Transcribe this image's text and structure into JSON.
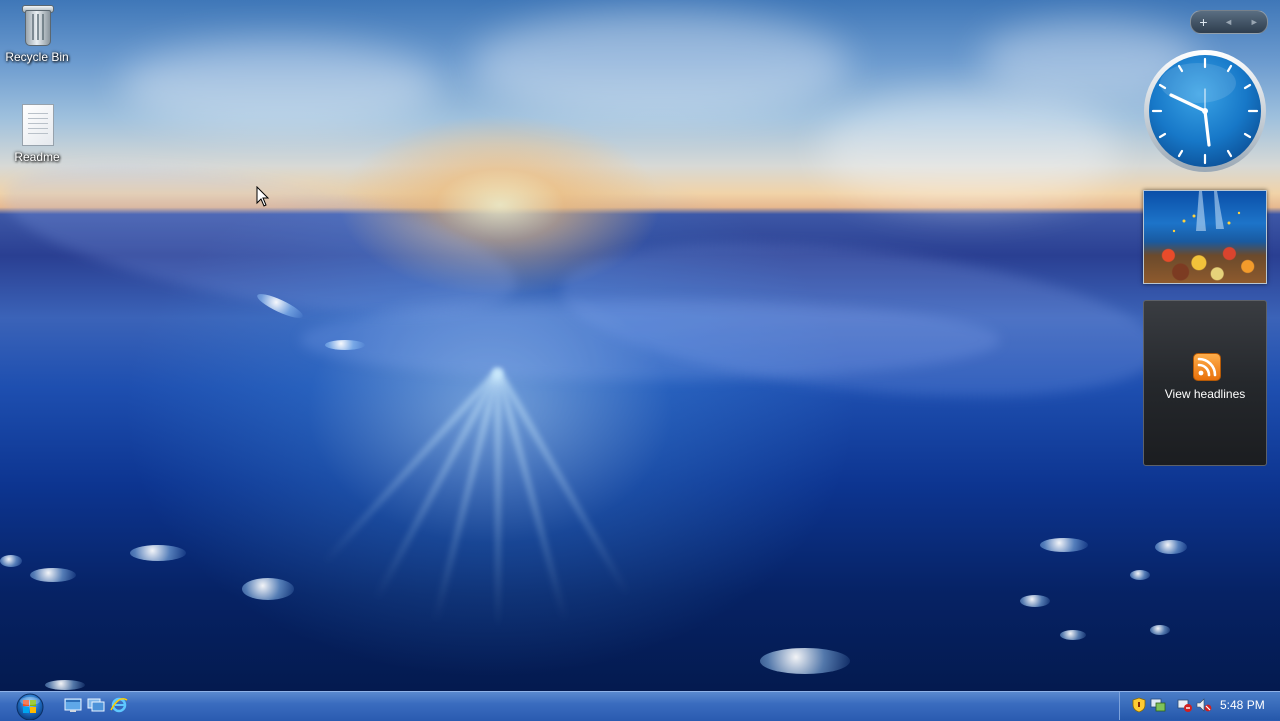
{
  "desktop": {
    "icons": [
      {
        "label": "Recycle Bin"
      },
      {
        "label": "Readme"
      }
    ]
  },
  "gadgets": {
    "toolbar": {
      "add_symbol": "+",
      "prev_symbol": "◄",
      "next_symbol": "►"
    },
    "clock_time": "5:48",
    "feed": {
      "label": "View headlines"
    }
  },
  "taskbar": {
    "time": "5:48 PM",
    "quick_launch": [
      "show-desktop-icon",
      "switch-windows-icon",
      "internet-explorer-icon"
    ],
    "tray_icons": [
      "security-shield-icon",
      "network-status-icon",
      "volume-icon",
      "flag-icon"
    ]
  },
  "colors": {
    "taskbar": "#3a6cbf",
    "accent_rss": "#e8710c"
  }
}
